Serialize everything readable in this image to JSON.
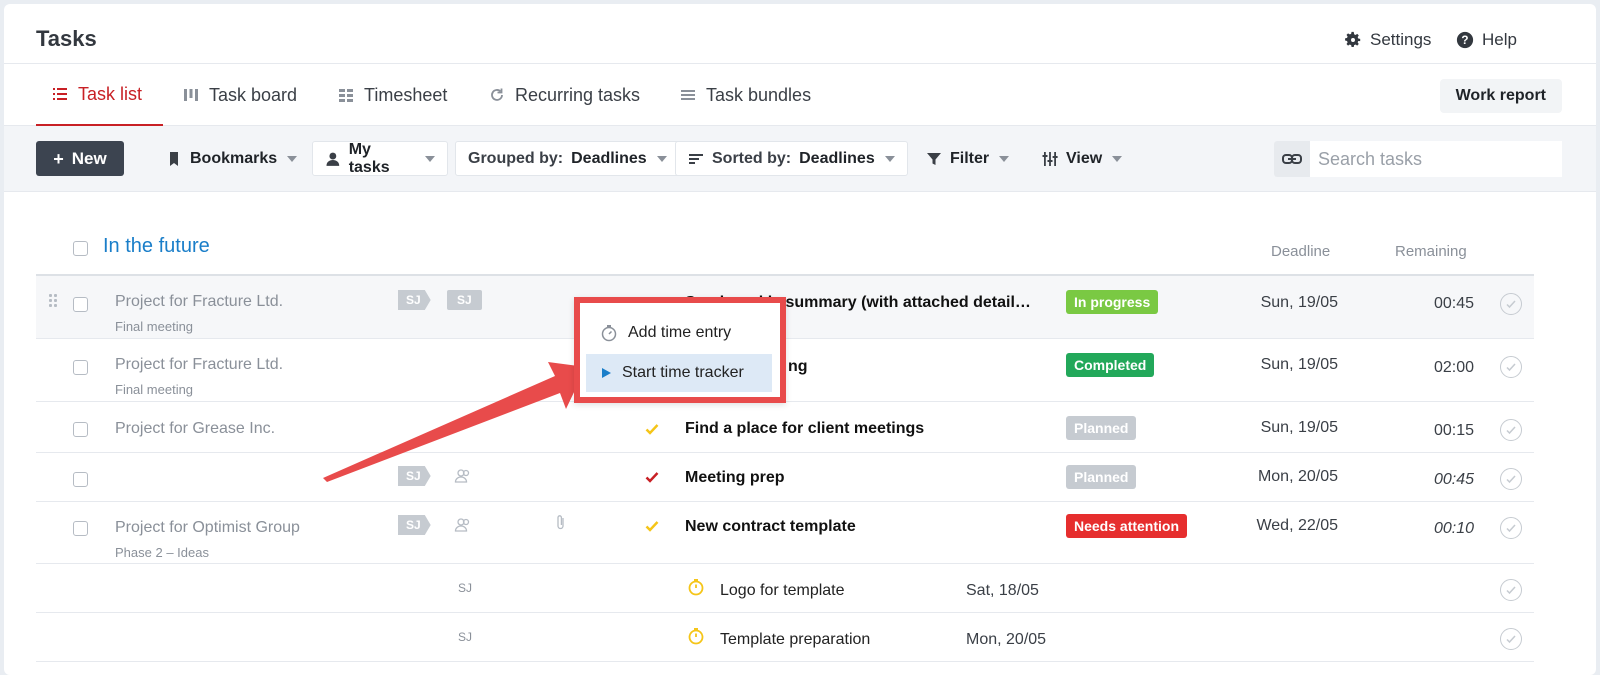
{
  "header": {
    "title": "Tasks",
    "settings_label": "Settings",
    "help_label": "Help"
  },
  "tabs": [
    {
      "label": "Task list",
      "icon": "list-icon",
      "active": true
    },
    {
      "label": "Task board",
      "icon": "board-icon"
    },
    {
      "label": "Timesheet",
      "icon": "timesheet-icon"
    },
    {
      "label": "Recurring tasks",
      "icon": "recurring-icon"
    },
    {
      "label": "Task bundles",
      "icon": "bundle-icon"
    }
  ],
  "work_report_label": "Work report",
  "toolbar": {
    "new_label": "New",
    "bookmarks_label": "Bookmarks",
    "my_tasks_label": "My tasks",
    "grouped_prefix": "Grouped by:",
    "grouped_value": "Deadlines",
    "sorted_prefix": "Sorted by:",
    "sorted_value": "Deadlines",
    "filter_label": "Filter",
    "view_label": "View",
    "search_placeholder": "Search tasks"
  },
  "group": {
    "title": "In the future",
    "col_deadline": "Deadline",
    "col_remaining": "Remaining"
  },
  "rows": [
    {
      "project": "Project for Fracture Ltd.",
      "sub": "Final meeting",
      "tag1": "SJ",
      "tag2": "SJ",
      "name": "Send weekly summary (with attached detail…",
      "status": "In progress",
      "status_color": "#7ac943",
      "deadline": "Sun, 19/05",
      "remaining": "00:45"
    },
    {
      "project": "Project for Fracture Ltd.",
      "sub": "Final meeting",
      "name": "ng",
      "status": "Completed",
      "status_color": "#22a85a",
      "deadline": "Sun, 19/05",
      "remaining": "02:00"
    },
    {
      "project": "Project for Grease Inc.",
      "name": "Find a place for client meetings",
      "status": "Planned",
      "status_color": "#c6cbd1",
      "deadline": "Sun, 19/05",
      "remaining": "00:15"
    },
    {
      "project": "",
      "tag1": "SJ",
      "name": "Meeting prep",
      "status": "Planned",
      "status_color": "#c6cbd1",
      "deadline": "Mon, 20/05",
      "remaining": "00:45"
    },
    {
      "project": "Project for Optimist Group",
      "sub": "Phase 2 – Ideas",
      "tag1": "SJ",
      "name": "New contract template",
      "status": "Needs attention",
      "status_color": "#e62e2e",
      "deadline": "Wed, 22/05",
      "remaining": "00:10"
    }
  ],
  "subtasks": [
    {
      "initials": "SJ",
      "name": "Logo for template",
      "date": "Sat, 18/05"
    },
    {
      "initials": "SJ",
      "name": "Template preparation",
      "date": "Mon, 20/05"
    }
  ],
  "popup": {
    "add_time_label": "Add time entry",
    "start_tracker_label": "Start time tracker"
  },
  "colors": {
    "accent_red": "#c82025",
    "link_blue": "#1a7ec9",
    "annotation_red": "#e84b4b"
  }
}
